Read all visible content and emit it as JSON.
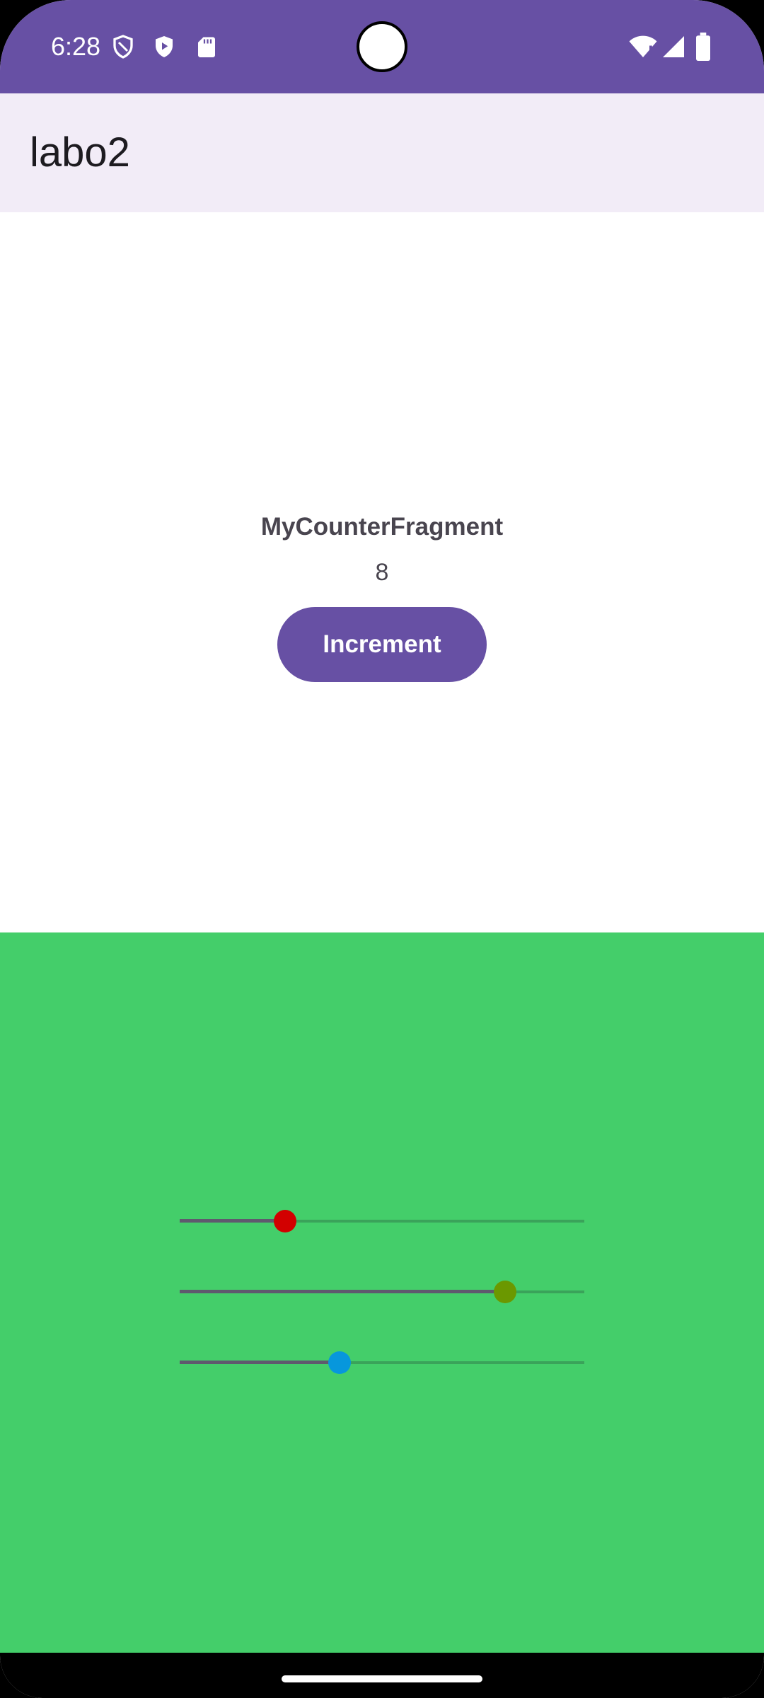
{
  "status_bar": {
    "time": "6:28",
    "color": "#6750A4",
    "icons": [
      "shield-outline-icon",
      "play-protect-icon",
      "sd-card-icon",
      "wifi-icon",
      "signal-icon",
      "battery-icon"
    ]
  },
  "app_bar": {
    "title": "labo2"
  },
  "counter_fragment": {
    "label": "MyCounterFragment",
    "count": "8",
    "button_label": "Increment",
    "button_color": "#6750A4"
  },
  "slider_fragment": {
    "background_color": "#44CE6A",
    "sliders": [
      {
        "name": "red",
        "value_fraction": 0.26,
        "thumb_color": "#D20000"
      },
      {
        "name": "green",
        "value_fraction": 0.805,
        "thumb_color": "#6B9800"
      },
      {
        "name": "blue",
        "value_fraction": 0.395,
        "thumb_color": "#0797DC"
      }
    ]
  }
}
